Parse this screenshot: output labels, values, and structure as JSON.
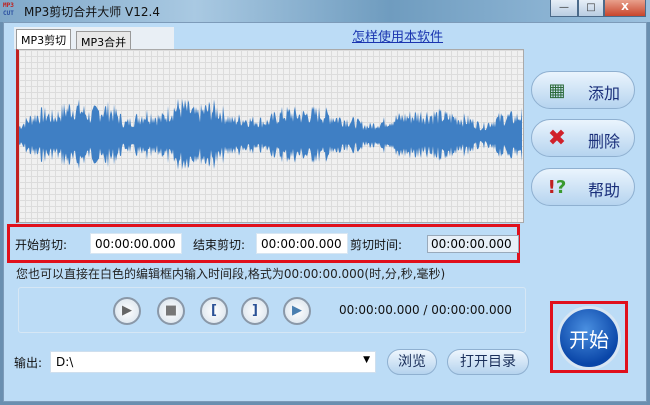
{
  "window": {
    "title": "MP3剪切合并大师 V12.4",
    "logo_text": "MP3 CUT",
    "minimize": "—",
    "maximize": "□",
    "close": "X"
  },
  "tabs": [
    {
      "label": "MP3剪切",
      "active": true
    },
    {
      "label": "MP3合并",
      "active": false
    }
  ],
  "help_link": "怎样使用本软件",
  "side_buttons": [
    {
      "label": "添加",
      "icon": "film-add-icon"
    },
    {
      "label": "删除",
      "icon": "red-x-icon"
    },
    {
      "label": "帮助",
      "icon": "help-icon"
    }
  ],
  "cut": {
    "start_label": "开始剪切:",
    "start_value": "00:00:00.000",
    "end_label": "结束剪切:",
    "end_value": "00:00:00.000",
    "duration_label": "剪切时间:",
    "duration_value": "00:00:00.000"
  },
  "hint": "您也可以直接在白色的编辑框内输入时间段,格式为00:00:00.000(时,分,秒,毫秒)",
  "player": {
    "time": "00:00:00.000 / 00:00:00.000"
  },
  "start_button": "开始",
  "output": {
    "label": "输出:",
    "value": "D:\\",
    "browse": "浏览",
    "open_dir": "打开目录"
  },
  "colors": {
    "wave": "#3f7fc4",
    "highlight": "#e0101c"
  }
}
